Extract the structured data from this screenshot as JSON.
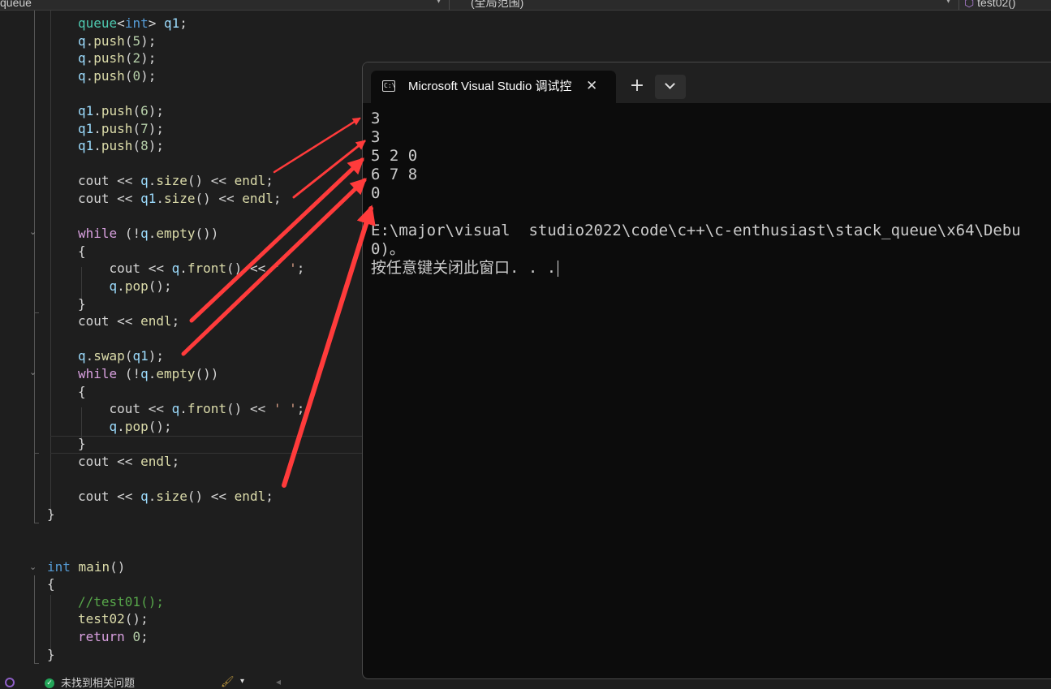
{
  "toolbar": {
    "file_scope": "queue",
    "scope": "(全局范围)",
    "function": "test02()"
  },
  "code": {
    "lines": [
      [
        {
          "t": "queue",
          "c": "typ"
        },
        {
          "t": "<",
          "c": "txt"
        },
        {
          "t": "int",
          "c": "kw"
        },
        {
          "t": "> ",
          "c": "txt"
        },
        {
          "t": "q1",
          "c": "var"
        },
        {
          "t": ";",
          "c": "txt"
        }
      ],
      [
        {
          "t": "q",
          "c": "var"
        },
        {
          "t": ".",
          "c": "txt"
        },
        {
          "t": "push",
          "c": "fn"
        },
        {
          "t": "(",
          "c": "txt"
        },
        {
          "t": "5",
          "c": "num"
        },
        {
          "t": ");",
          "c": "txt"
        }
      ],
      [
        {
          "t": "q",
          "c": "var"
        },
        {
          "t": ".",
          "c": "txt"
        },
        {
          "t": "push",
          "c": "fn"
        },
        {
          "t": "(",
          "c": "txt"
        },
        {
          "t": "2",
          "c": "num"
        },
        {
          "t": ");",
          "c": "txt"
        }
      ],
      [
        {
          "t": "q",
          "c": "var"
        },
        {
          "t": ".",
          "c": "txt"
        },
        {
          "t": "push",
          "c": "fn"
        },
        {
          "t": "(",
          "c": "txt"
        },
        {
          "t": "0",
          "c": "num"
        },
        {
          "t": ");",
          "c": "txt"
        }
      ],
      [],
      [
        {
          "t": "q1",
          "c": "var"
        },
        {
          "t": ".",
          "c": "txt"
        },
        {
          "t": "push",
          "c": "fn"
        },
        {
          "t": "(",
          "c": "txt"
        },
        {
          "t": "6",
          "c": "num"
        },
        {
          "t": ");",
          "c": "txt"
        }
      ],
      [
        {
          "t": "q1",
          "c": "var"
        },
        {
          "t": ".",
          "c": "txt"
        },
        {
          "t": "push",
          "c": "fn"
        },
        {
          "t": "(",
          "c": "txt"
        },
        {
          "t": "7",
          "c": "num"
        },
        {
          "t": ");",
          "c": "txt"
        }
      ],
      [
        {
          "t": "q1",
          "c": "var"
        },
        {
          "t": ".",
          "c": "txt"
        },
        {
          "t": "push",
          "c": "fn"
        },
        {
          "t": "(",
          "c": "txt"
        },
        {
          "t": "8",
          "c": "num"
        },
        {
          "t": ");",
          "c": "txt"
        }
      ],
      [],
      [
        {
          "t": "cout",
          "c": "txt"
        },
        {
          "t": " << ",
          "c": "txt"
        },
        {
          "t": "q",
          "c": "var"
        },
        {
          "t": ".",
          "c": "txt"
        },
        {
          "t": "size",
          "c": "fn"
        },
        {
          "t": "() << ",
          "c": "txt"
        },
        {
          "t": "endl",
          "c": "fn"
        },
        {
          "t": ";",
          "c": "txt"
        }
      ],
      [
        {
          "t": "cout",
          "c": "txt"
        },
        {
          "t": " << ",
          "c": "txt"
        },
        {
          "t": "q1",
          "c": "var"
        },
        {
          "t": ".",
          "c": "txt"
        },
        {
          "t": "size",
          "c": "fn"
        },
        {
          "t": "() << ",
          "c": "txt"
        },
        {
          "t": "endl",
          "c": "fn"
        },
        {
          "t": ";",
          "c": "txt"
        }
      ],
      [],
      [
        {
          "t": "while",
          "c": "ctl"
        },
        {
          "t": " (!",
          "c": "txt"
        },
        {
          "t": "q",
          "c": "var"
        },
        {
          "t": ".",
          "c": "txt"
        },
        {
          "t": "empty",
          "c": "fn"
        },
        {
          "t": "())",
          "c": "txt"
        }
      ],
      [
        {
          "t": "{",
          "c": "txt"
        }
      ],
      [
        {
          "t": "    cout",
          "c": "txt"
        },
        {
          "t": " << ",
          "c": "txt"
        },
        {
          "t": "q",
          "c": "var"
        },
        {
          "t": ".",
          "c": "txt"
        },
        {
          "t": "front",
          "c": "fn"
        },
        {
          "t": "() << ",
          "c": "txt"
        },
        {
          "t": "' '",
          "c": "str"
        },
        {
          "t": ";",
          "c": "txt"
        }
      ],
      [
        {
          "t": "    ",
          "c": "txt"
        },
        {
          "t": "q",
          "c": "var"
        },
        {
          "t": ".",
          "c": "txt"
        },
        {
          "t": "pop",
          "c": "fn"
        },
        {
          "t": "();",
          "c": "txt"
        }
      ],
      [
        {
          "t": "}",
          "c": "txt"
        }
      ],
      [
        {
          "t": "cout",
          "c": "txt"
        },
        {
          "t": " << ",
          "c": "txt"
        },
        {
          "t": "endl",
          "c": "fn"
        },
        {
          "t": ";",
          "c": "txt"
        }
      ],
      [],
      [
        {
          "t": "q",
          "c": "var"
        },
        {
          "t": ".",
          "c": "txt"
        },
        {
          "t": "swap",
          "c": "fn"
        },
        {
          "t": "(",
          "c": "txt"
        },
        {
          "t": "q1",
          "c": "var"
        },
        {
          "t": ");",
          "c": "txt"
        }
      ],
      [
        {
          "t": "while",
          "c": "ctl"
        },
        {
          "t": " (!",
          "c": "txt"
        },
        {
          "t": "q",
          "c": "var"
        },
        {
          "t": ".",
          "c": "txt"
        },
        {
          "t": "empty",
          "c": "fn"
        },
        {
          "t": "())",
          "c": "txt"
        }
      ],
      [
        {
          "t": "{",
          "c": "txt"
        }
      ],
      [
        {
          "t": "    cout",
          "c": "txt"
        },
        {
          "t": " << ",
          "c": "txt"
        },
        {
          "t": "q",
          "c": "var"
        },
        {
          "t": ".",
          "c": "txt"
        },
        {
          "t": "front",
          "c": "fn"
        },
        {
          "t": "() << ",
          "c": "txt"
        },
        {
          "t": "' '",
          "c": "str"
        },
        {
          "t": ";",
          "c": "txt"
        }
      ],
      [
        {
          "t": "    ",
          "c": "txt"
        },
        {
          "t": "q",
          "c": "var"
        },
        {
          "t": ".",
          "c": "txt"
        },
        {
          "t": "pop",
          "c": "fn"
        },
        {
          "t": "();",
          "c": "txt"
        }
      ],
      [
        {
          "t": "}",
          "c": "txt"
        }
      ],
      [
        {
          "t": "cout",
          "c": "txt"
        },
        {
          "t": " << ",
          "c": "txt"
        },
        {
          "t": "endl",
          "c": "fn"
        },
        {
          "t": ";",
          "c": "txt"
        }
      ],
      [],
      [
        {
          "t": "cout",
          "c": "txt"
        },
        {
          "t": " << ",
          "c": "txt"
        },
        {
          "t": "q",
          "c": "var"
        },
        {
          "t": ".",
          "c": "txt"
        },
        {
          "t": "size",
          "c": "fn"
        },
        {
          "t": "() << ",
          "c": "txt"
        },
        {
          "t": "endl",
          "c": "fn"
        },
        {
          "t": ";",
          "c": "txt"
        }
      ],
      [
        {
          "t": "}",
          "c": "txt"
        }
      ],
      [],
      [],
      [
        {
          "t": "int",
          "c": "kw"
        },
        {
          "t": " ",
          "c": "txt"
        },
        {
          "t": "main",
          "c": "fn"
        },
        {
          "t": "()",
          "c": "txt"
        }
      ],
      [
        {
          "t": "{",
          "c": "txt"
        }
      ],
      [
        {
          "t": "//test01();",
          "c": "com"
        }
      ],
      [
        {
          "t": "test02",
          "c": "fn"
        },
        {
          "t": "();",
          "c": "txt"
        }
      ],
      [
        {
          "t": "return",
          "c": "ctl"
        },
        {
          "t": " ",
          "c": "txt"
        },
        {
          "t": "0",
          "c": "num"
        },
        {
          "t": ";",
          "c": "txt"
        }
      ],
      [
        {
          "t": "}",
          "c": "txt"
        }
      ]
    ]
  },
  "terminal": {
    "tab_title": "Microsoft Visual Studio 调试控",
    "icon_glyph": "C:\\",
    "output": [
      "3",
      "3",
      "5 2 0",
      "6 7 8",
      "0",
      "",
      "E:\\major\\visual  studio2022\\code\\c++\\c-enthusiast\\stack_queue\\x64\\Debu",
      "0)。",
      "按任意键关闭此窗口. . ."
    ]
  },
  "status": {
    "issues_text": "未找到相关问题"
  },
  "colors": {
    "annotation_arrow": "#ff3b3b",
    "editor_bg": "#1e1e1e",
    "terminal_bg": "#0c0c0c"
  }
}
